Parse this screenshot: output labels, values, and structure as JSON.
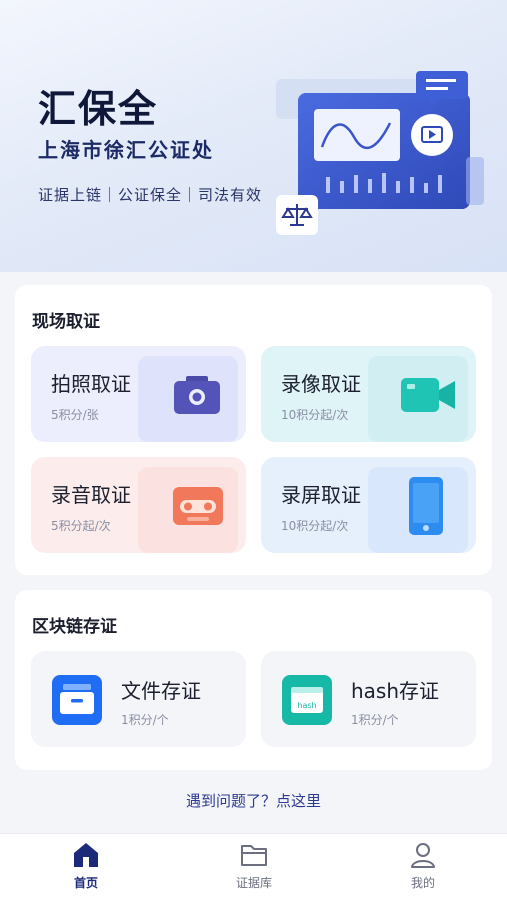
{
  "hero": {
    "title": "汇保全",
    "subtitle": "上海市徐汇公证处",
    "tags": "证据上链｜公证保全｜司法有效"
  },
  "sections": {
    "onsite": {
      "title": "现场取证",
      "tiles": [
        {
          "name": "拍照取证",
          "price": "5积分/张",
          "icon": "camera-icon"
        },
        {
          "name": "录像取证",
          "price": "10积分起/次",
          "icon": "video-camera-icon"
        },
        {
          "name": "录音取证",
          "price": "5积分起/次",
          "icon": "cassette-icon"
        },
        {
          "name": "录屏取证",
          "price": "10积分起/次",
          "icon": "phone-icon"
        }
      ]
    },
    "blockchain": {
      "title": "区块链存证",
      "tiles": [
        {
          "name": "文件存证",
          "price": "1积分/个",
          "icon": "file-box-icon"
        },
        {
          "name": "hash存证",
          "price": "1积分/个",
          "icon": "hash-card-icon",
          "icon_text": "hash"
        }
      ]
    }
  },
  "help_link": "遇到问题了？点这里",
  "tabbar": {
    "items": [
      {
        "label": "首页",
        "icon": "home-icon",
        "active": true
      },
      {
        "label": "证据库",
        "icon": "folder-icon",
        "active": false
      },
      {
        "label": "我的",
        "icon": "profile-icon",
        "active": false
      }
    ]
  },
  "colors": {
    "brand": "#1d2a7a",
    "photo_tile": "#ecedfd",
    "video_tile": "#dff4f6",
    "audio_tile": "#fdecec",
    "screen_tile": "#e6f0fd"
  }
}
